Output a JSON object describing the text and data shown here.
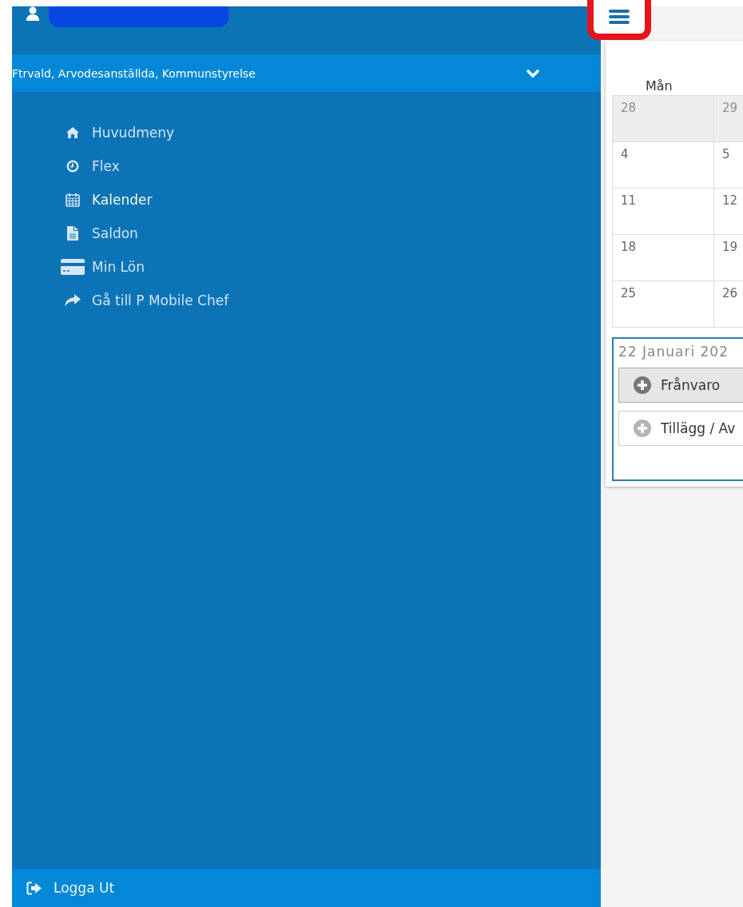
{
  "sidebar": {
    "account": "Ftrvald, Arvodesanställda, Kommunstyrelse",
    "items": [
      {
        "label": "Huvudmeny",
        "selected": false
      },
      {
        "label": "Flex",
        "selected": false
      },
      {
        "label": "Kalender",
        "selected": true
      },
      {
        "label": "Saldon",
        "selected": false
      },
      {
        "label": "Min Lön",
        "selected": false
      },
      {
        "label": "Gå till P Mobile Chef",
        "selected": false
      }
    ],
    "logout": "Logga Ut"
  },
  "calendar": {
    "weekday": "Mån",
    "rows": [
      [
        {
          "day": "28",
          "outside_month": true
        },
        {
          "day": "29",
          "outside_month": true
        }
      ],
      [
        {
          "day": "4",
          "outside_month": false
        },
        {
          "day": "5",
          "outside_month": false
        }
      ],
      [
        {
          "day": "11",
          "outside_month": false
        },
        {
          "day": "12",
          "outside_month": false
        }
      ],
      [
        {
          "day": "18",
          "outside_month": false
        },
        {
          "day": "19",
          "outside_month": false
        }
      ],
      [
        {
          "day": "25",
          "outside_month": false
        },
        {
          "day": "26",
          "outside_month": false
        }
      ]
    ]
  },
  "day_panel": {
    "title": "22 Januari 202",
    "actions": [
      {
        "label": "Frånvaro",
        "highlighted": true
      },
      {
        "label": "Tillägg / Av",
        "highlighted": false
      }
    ]
  }
}
